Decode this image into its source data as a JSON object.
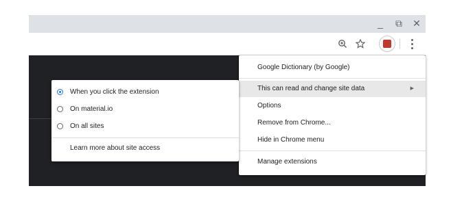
{
  "window_controls": {
    "minimize": "_",
    "restore": "⧉",
    "close": "✕"
  },
  "toolbar": {
    "zoom_icon": "zoom-icon",
    "bookmark_icon": "star-icon",
    "extension_icon": "extension-icon",
    "menu_icon": "more-vert-icon"
  },
  "context_menu": {
    "items": [
      {
        "label": "Google Dictionary (by Google)"
      },
      {
        "label": "This can read and change site data",
        "submenu": true
      },
      {
        "label": "Options"
      },
      {
        "label": "Remove from Chrome..."
      },
      {
        "label": "Hide in Chrome menu"
      },
      {
        "label": "Manage extensions"
      }
    ],
    "submenu_arrow": "▶"
  },
  "site_access_menu": {
    "options": [
      {
        "label": "When you click the extension",
        "selected": true
      },
      {
        "label": "On material.io",
        "selected": false
      },
      {
        "label": "On all sites",
        "selected": false
      }
    ],
    "learn_more": "Learn more about site access"
  },
  "colors": {
    "accent": "#1a73e8",
    "titlebar": "#dee1e6",
    "page_background": "#202124",
    "extension_icon": "#c0392b"
  }
}
